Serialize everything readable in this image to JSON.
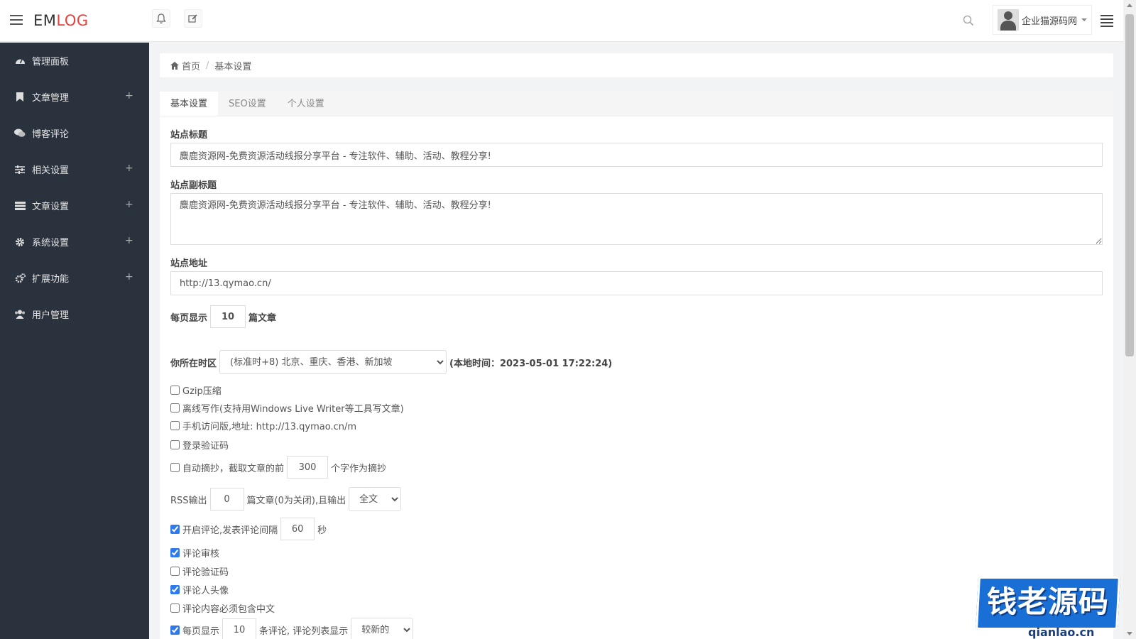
{
  "header": {
    "logo_em": "EM",
    "logo_log": "LOG",
    "user_name": "企业猫源码网"
  },
  "sidebar": {
    "items": [
      {
        "label": "管理面板",
        "icon": "dashboard-icon",
        "expandable": false
      },
      {
        "label": "文章管理",
        "icon": "bookmark-icon",
        "expandable": true
      },
      {
        "label": "博客评论",
        "icon": "comments-icon",
        "expandable": false
      },
      {
        "label": "相关设置",
        "icon": "sliders-icon",
        "expandable": true
      },
      {
        "label": "文章设置",
        "icon": "list-icon",
        "expandable": true
      },
      {
        "label": "系统设置",
        "icon": "gear-icon",
        "expandable": true
      },
      {
        "label": "扩展功能",
        "icon": "cogs-icon",
        "expandable": true
      },
      {
        "label": "用户管理",
        "icon": "users-icon",
        "expandable": false
      }
    ],
    "plus_symbol": "+"
  },
  "breadcrumb": {
    "home": "首页",
    "separator": "/",
    "current": "基本设置"
  },
  "tabs": [
    "基本设置",
    "SEO设置",
    "个人设置"
  ],
  "form": {
    "site_title_label": "站点标题",
    "site_title_value": "麋鹿资源网-免费资源活动线报分享平台 - 专注软件、辅助、活动、教程分享!",
    "site_subtitle_label": "站点副标题",
    "site_subtitle_value": "麋鹿资源网-免费资源活动线报分享平台 - 专注软件、辅助、活动、教程分享!",
    "site_url_label": "站点地址",
    "site_url_value": "http://13.qymao.cn/",
    "per_page_prefix": "每页显示",
    "per_page_value": "10",
    "per_page_suffix": "篇文章",
    "timezone_label": "你所在时区",
    "timezone_selected": "(标准时+8) 北京、重庆、香港、新加坡",
    "local_time": "(本地时间：2023-05-01 17:22:24)",
    "gzip_label": "Gzip压缩",
    "offline_write_label": "离线写作(支持用Windows Live Writer等工具写文章)",
    "mobile_label": "手机访问版,地址: http://13.qymao.cn/m",
    "login_captcha_label": "登录验证码",
    "auto_excerpt_prefix": "自动摘抄，截取文章的前",
    "auto_excerpt_value": "300",
    "auto_excerpt_suffix": "个字作为摘抄",
    "rss_prefix": "RSS输出",
    "rss_value": "0",
    "rss_middle": "篇文章(0为关闭),且输出",
    "rss_selected": "全文",
    "comment_enable_prefix": "开启评论,发表评论间隔",
    "comment_interval_value": "60",
    "comment_interval_suffix": "秒",
    "comment_review_label": "评论审核",
    "comment_captcha_label": "评论验证码",
    "comment_avatar_label": "评论人头像",
    "comment_chinese_label": "评论内容必须包含中文",
    "comment_per_page_prefix": "每页显示",
    "comment_per_page_value": "10",
    "comment_per_page_middle": "条评论, 评论列表显示",
    "comment_order_selected": "较新的"
  },
  "checkboxes": {
    "gzip": false,
    "offline_write": false,
    "mobile": false,
    "login_captcha": false,
    "auto_excerpt": false,
    "comment_enable": true,
    "comment_review": true,
    "comment_captcha": false,
    "comment_avatar": true,
    "comment_chinese": false,
    "comment_per_page": true
  },
  "watermark": {
    "text": "钱老源码",
    "sub": "qianlao.cn"
  },
  "colors": {
    "sidebar_bg": "#2a323d",
    "logo_red": "#e8413b",
    "checkbox_blue": "#3079ed",
    "watermark_blue": "#1a6fd6"
  }
}
